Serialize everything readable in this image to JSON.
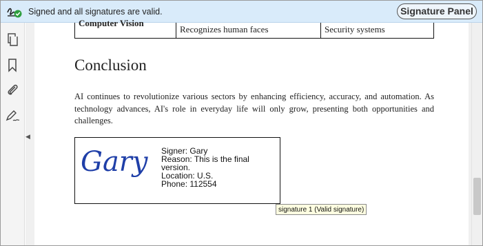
{
  "signature_bar": {
    "status_icon": "signature-valid-icon",
    "status_text": "Signed and all signatures are valid.",
    "panel_button_label": "Signature Panel"
  },
  "left_rail": {
    "tools": [
      "pages-icon",
      "bookmark-icon",
      "attachment-icon",
      "sign-icon"
    ],
    "collapse_icon": "collapse-left-icon"
  },
  "document": {
    "table_row": {
      "col1": "Computer Vision",
      "col2": "Recognizes human faces",
      "col3": "Security systems"
    },
    "heading": "Conclusion",
    "paragraph": "AI continues to revolutionize various sectors by enhancing efficiency, accuracy, and automation. As technology advances, AI's role in everyday life will only grow, presenting both opportunities and challenges.",
    "signature": {
      "handwritten_name": "Gary",
      "signer": "Signer: Gary",
      "reason": "Reason: This is the final version.",
      "location": "Location: U.S.",
      "phone": "Phone: 112554",
      "ink_color": "#1f3fa8"
    },
    "tooltip": "signature 1 (Valid signature)"
  },
  "colors": {
    "bar_background": "#d9ebfa",
    "valid_green": "#2e9e3e"
  }
}
